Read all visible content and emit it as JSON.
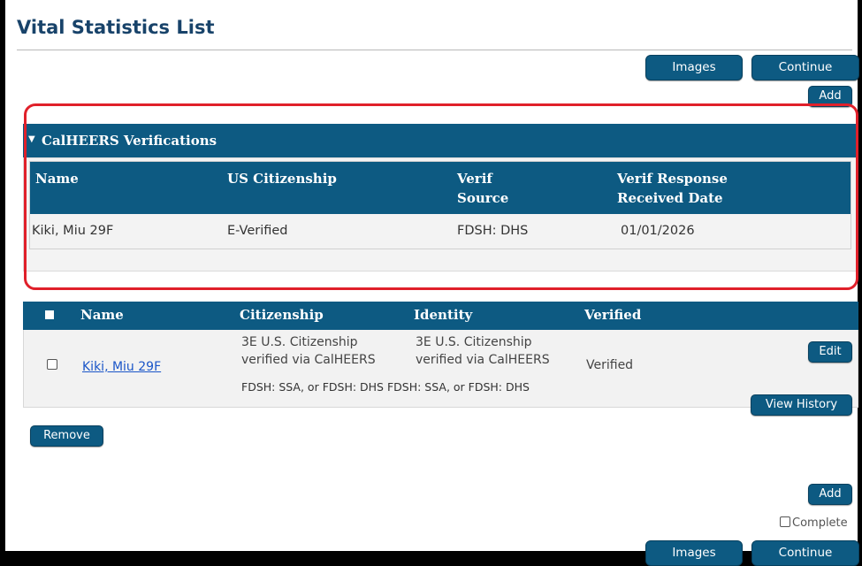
{
  "page": {
    "title": "Vital Statistics List"
  },
  "top_buttons": {
    "images": "Images",
    "continue": "Continue",
    "add": "Add"
  },
  "verifications": {
    "section_title": "CalHEERS Verifications",
    "headers": {
      "name": "Name",
      "citizenship": "US Citizenship",
      "source_l1": "Verif",
      "source_l2": "Source",
      "date_l1": "Verif Response",
      "date_l2": "Received Date"
    },
    "row": {
      "name": "Kiki, Miu 29F",
      "citizenship": "E-Verified",
      "source": "FDSH: DHS",
      "date": "01/01/2026"
    }
  },
  "list": {
    "headers": {
      "name": "Name",
      "citizenship": "Citizenship",
      "identity": "Identity",
      "verified": "Verified"
    },
    "row": {
      "name": "Kiki, Miu 29F",
      "citizenship_l1": "3E U.S. Citizenship",
      "citizenship_l2": "verified via CalHEERS",
      "identity_l1": "3E U.S. Citizenship",
      "identity_l2": "verified via CalHEERS",
      "fdsh_text": "FDSH: SSA, or FDSH: DHS FDSH: SSA, or FDSH: DHS",
      "verified": "Verified",
      "edit": "Edit",
      "view_history": "View History"
    }
  },
  "bottom": {
    "remove": "Remove",
    "add": "Add",
    "complete": "Complete",
    "images": "Images",
    "continue": "Continue"
  },
  "colors": {
    "brand": "#0d5a82",
    "title": "#18436a",
    "highlight": "#e0202a",
    "link": "#1a55c8"
  }
}
